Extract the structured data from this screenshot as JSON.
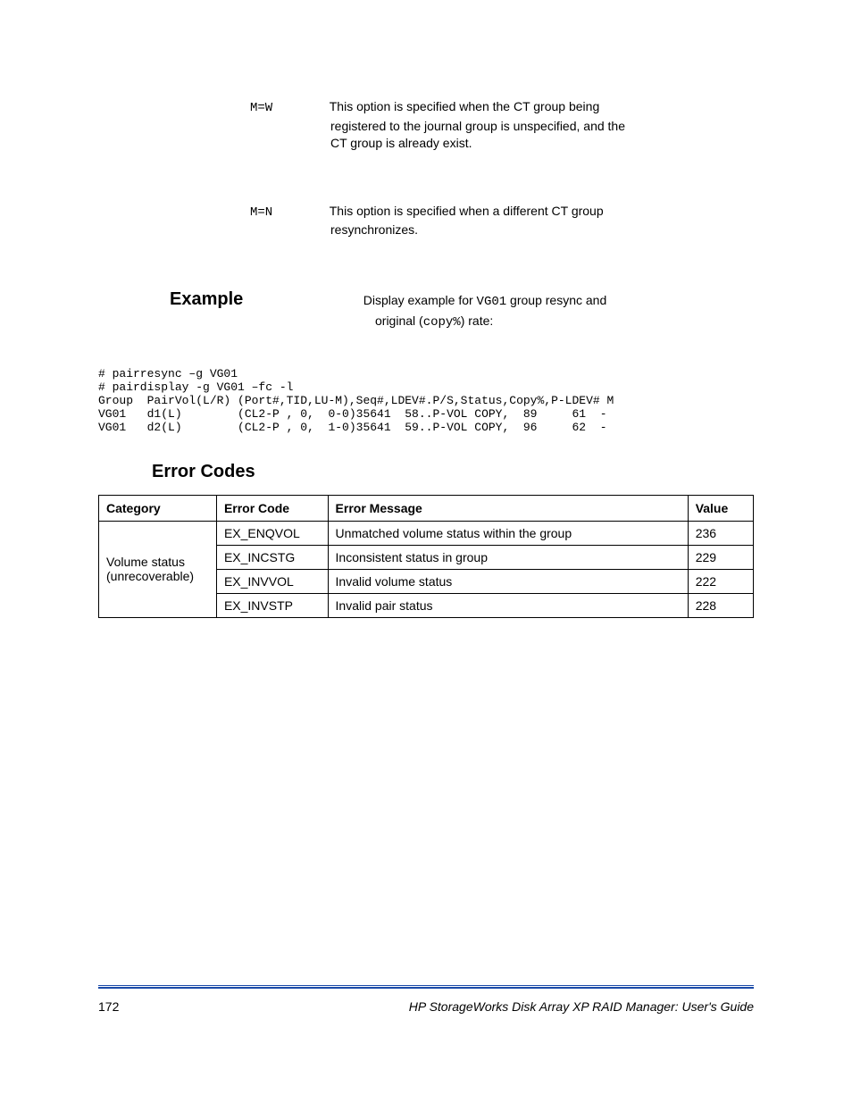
{
  "paragraphs": {
    "mw_line1": "This option is specified when the CT group being",
    "mw_code": "M=W",
    "mw_line2": "registered to the journal group is unspecified, and the",
    "mw_line3": "CT group is already exist.",
    "mn_code": "M=N",
    "mn_line1": "This option is specified when a different CT group",
    "mn_line2": "resynchronizes."
  },
  "example": {
    "label": "Example",
    "text1a": "Display example for ",
    "text1_code": "VG01",
    "text1b": " group resync and",
    "text2a": "original (",
    "text2_code": "copy%",
    "text2b": ") rate:"
  },
  "code": "# pairresync –g VG01\n# pairdisplay -g VG01 –fc -l \nGroup  PairVol(L/R) (Port#,TID,LU-M),Seq#,LDEV#.P/S,Status,Copy%,P-LDEV# M\nVG01   d1(L)        (CL2-P , 0,  0-0)35641  58..P-VOL COPY,  89     61  -\nVG01   d2(L)        (CL2-P , 0,  1-0)35641  59..P-VOL COPY,  96     62  -",
  "errcodes": {
    "heading": "Error Codes",
    "headers": {
      "category": "Category",
      "code": "Error Code",
      "message": "Error Message",
      "value": "Value"
    },
    "rows": [
      {
        "category": "Volume status (unrecoverable)",
        "code": "EX_ENQVOL",
        "message": "Unmatched volume status within the group",
        "value": "236"
      },
      {
        "category": "",
        "code": "EX_INCSTG",
        "message": "Inconsistent status in group",
        "value": "229"
      },
      {
        "category": "",
        "code": "EX_INVVOL",
        "message": "Invalid volume status",
        "value": "222"
      },
      {
        "category": "",
        "code": "EX_INVSTP",
        "message": "Invalid pair status",
        "value": "228"
      }
    ]
  },
  "footer": {
    "page": "172",
    "title": "HP StorageWorks Disk Array XP RAID Manager: User's Guide"
  }
}
